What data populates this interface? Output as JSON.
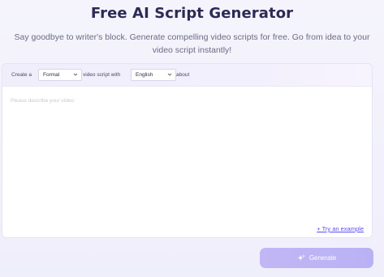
{
  "header": {
    "title": "Free AI Script Generator",
    "subtitle_line1": "Say goodbye to writer's block. Generate compelling video scripts for free. Go from idea to your",
    "subtitle_line2": "video script instantly!"
  },
  "options": {
    "prefix": "Create a",
    "tone_value": "Formal",
    "middle": "video script with",
    "language_value": "English",
    "suffix": "about"
  },
  "prompt": {
    "placeholder": "Please describe your video",
    "value": ""
  },
  "try_example_label": "+ Try an example",
  "generate_button": {
    "label": "Generate",
    "icon": "sparkle-icon"
  },
  "colors": {
    "title": "#2d2a55",
    "accent": "#5b4ef0",
    "button": "#c2b6f5"
  }
}
